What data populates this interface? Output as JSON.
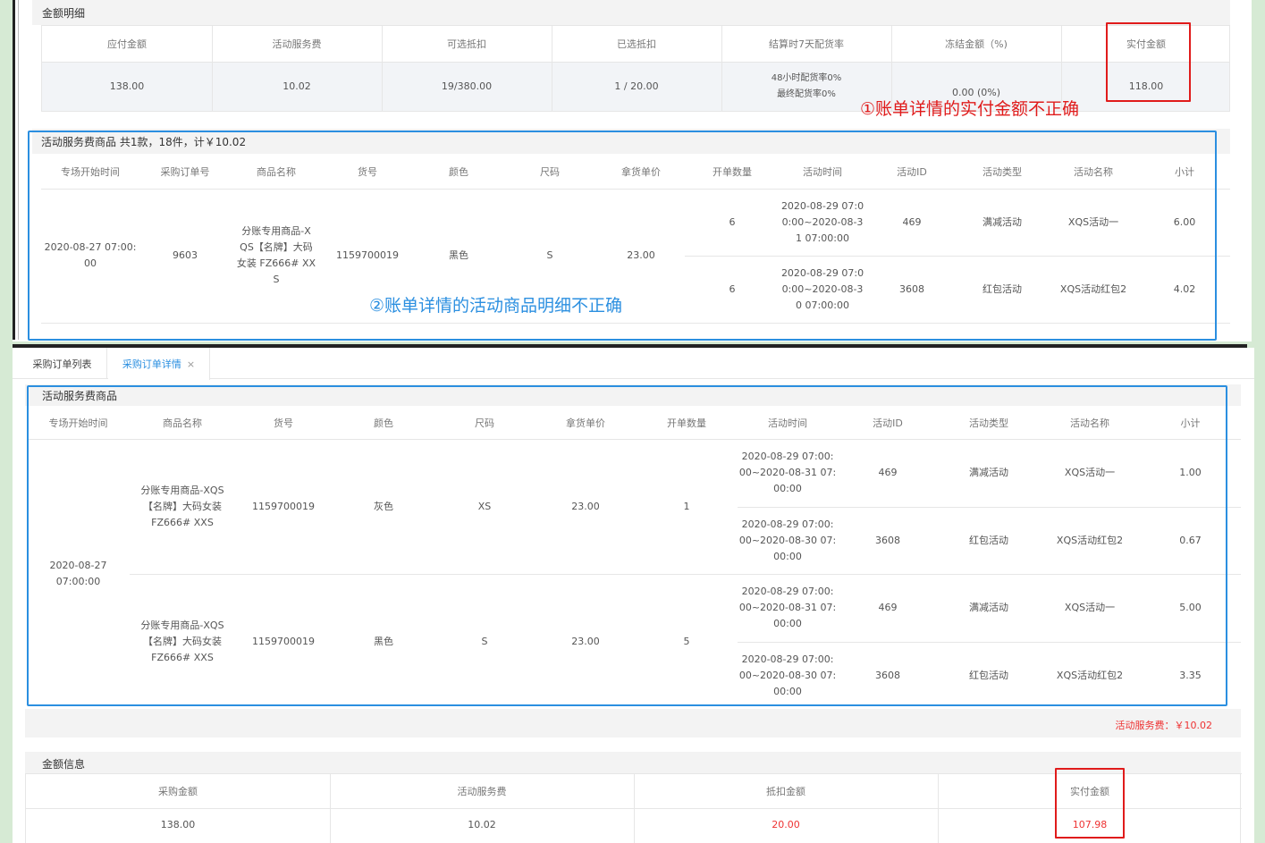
{
  "top": {
    "amount_section_title": "金额明细",
    "amount_headers": [
      "应付金额",
      "活动服务费",
      "可选抵扣",
      "已选抵扣",
      "结算时7天配货率",
      "冻结金额（%)",
      "实付金额"
    ],
    "amount_values": [
      "138.00",
      "10.02",
      "19/380.00",
      "1 / 20.00",
      "48小时配货率0%\n最终配货率0%",
      "0.00 (0%)",
      "118.00"
    ],
    "annotation_1": "①账单详情的实付金额不正确",
    "activity_section_title": "活动服务费商品 共1款，18件，计￥10.02",
    "activity_headers": [
      "专场开始时间",
      "采购订单号",
      "商品名称",
      "货号",
      "颜色",
      "尺码",
      "拿货单价",
      "开单数量",
      "活动时间",
      "活动ID",
      "活动类型",
      "活动名称",
      "小计"
    ],
    "row": {
      "start_time": "2020-08-27 07:00:\n00",
      "order_no": "9603",
      "product_name": "分账专用商品-X\nQS【名牌】大码\n女装 FZ666# XX\nS",
      "sku": "1159700019",
      "color": "黑色",
      "size": "S",
      "price": "23.00"
    },
    "sub_rows": [
      {
        "qty": "6",
        "time": "2020-08-29 07:0\n0:00~2020-08-3\n1 07:00:00",
        "id": "469",
        "type": "满减活动",
        "name": "XQS活动一",
        "subtotal": "6.00"
      },
      {
        "qty": "6",
        "time": "2020-08-29 07:0\n0:00~2020-08-3\n0 07:00:00",
        "id": "3608",
        "type": "红包活动",
        "name": "XQS活动红包2",
        "subtotal": "4.02"
      }
    ],
    "annotation_2": "②账单详情的活动商品明细不正确"
  },
  "bottom": {
    "tabs": [
      {
        "label": "采购订单列表",
        "active": false
      },
      {
        "label": "采购订单详情",
        "active": true,
        "close": "×"
      }
    ],
    "activity_section_title": "活动服务费商品",
    "activity_headers": [
      "专场开始时间",
      "商品名称",
      "货号",
      "颜色",
      "尺码",
      "拿货单价",
      "开单数量",
      "活动时间",
      "活动ID",
      "活动类型",
      "活动名称",
      "小计"
    ],
    "start_time": "2020-08-27 07:00:00",
    "products": [
      {
        "name": "分账专用商品-XQS\n【名牌】大码女装\nFZ666# XXS",
        "sku": "1159700019",
        "color": "灰色",
        "size": "XS",
        "price": "23.00",
        "qty": "1",
        "activities": [
          {
            "time": "2020-08-29 07:00:\n00~2020-08-31 07:\n00:00",
            "id": "469",
            "type": "满减活动",
            "name": "XQS活动一",
            "subtotal": "1.00"
          },
          {
            "time": "2020-08-29 07:00:\n00~2020-08-30 07:\n00:00",
            "id": "3608",
            "type": "红包活动",
            "name": "XQS活动红包2",
            "subtotal": "0.67"
          }
        ]
      },
      {
        "name": "分账专用商品-XQS\n【名牌】大码女装\nFZ666# XXS",
        "sku": "1159700019",
        "color": "黑色",
        "size": "S",
        "price": "23.00",
        "qty": "5",
        "activities": [
          {
            "time": "2020-08-29 07:00:\n00~2020-08-31 07:\n00:00",
            "id": "469",
            "type": "满减活动",
            "name": "XQS活动一",
            "subtotal": "5.00"
          },
          {
            "time": "2020-08-29 07:00:\n00~2020-08-30 07:\n00:00",
            "id": "3608",
            "type": "红包活动",
            "name": "XQS活动红包2",
            "subtotal": "3.35"
          }
        ]
      }
    ],
    "service_fee_total": "活动服务费：￥10.02",
    "amount_section_title": "金额信息",
    "amount_headers": [
      "采购金额",
      "活动服务费",
      "抵扣金额",
      "实付金额"
    ],
    "amount_values": [
      "138.00",
      "10.02",
      "20.00",
      "107.98"
    ]
  },
  "colors": {
    "annotation_red": "#e01b1b",
    "annotation_blue": "#2b8fe0",
    "value_red": "#e33"
  }
}
